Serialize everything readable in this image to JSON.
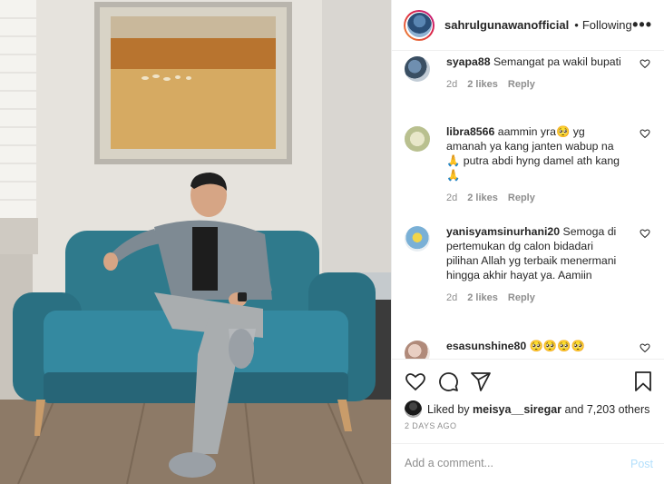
{
  "header": {
    "username": "sahrulgunawanofficial",
    "separator": "•",
    "follow_status": "Following",
    "more_label": "•••"
  },
  "comments": [
    {
      "username": "syapa88",
      "text": "Semangat pa wakil bupati",
      "age": "2d",
      "likes": "2 likes",
      "reply_label": "Reply"
    },
    {
      "username": "libra8566",
      "text": "aammin yra🥺 yg amanah ya kang janten wabup na 🙏 putra abdi hyng damel ath kang🙏",
      "age": "2d",
      "likes": "2 likes",
      "reply_label": "Reply"
    },
    {
      "username": "yanisyamsinurhani20",
      "text": "Semoga di pertemukan dg calon bidadari pilihan Allah yg terbaik menermani hingga akhir hayat ya. Aamiin",
      "age": "2d",
      "likes": "2 likes",
      "reply_label": "Reply"
    },
    {
      "username": "esasunshine80",
      "text": "🥺🥺🥺🥺",
      "age": "",
      "likes": "",
      "reply_label": ""
    }
  ],
  "actions": {
    "icons": [
      "heart-icon",
      "comment-icon",
      "share-icon",
      "bookmark-icon"
    ]
  },
  "likes_summary": {
    "prefix": "Liked by",
    "user": "meisya__siregar",
    "suffix": "and 7,203 others"
  },
  "post_date": "2 DAYS AGO",
  "comment_box": {
    "placeholder": "Add a comment...",
    "post_label": "Post"
  },
  "colors": {
    "gradient_start": "#f09433",
    "gradient_end": "#bc1888",
    "muted_text": "#8e8e8e",
    "post_disabled": "#b2dffc",
    "sofa": "#2f7a8c"
  }
}
